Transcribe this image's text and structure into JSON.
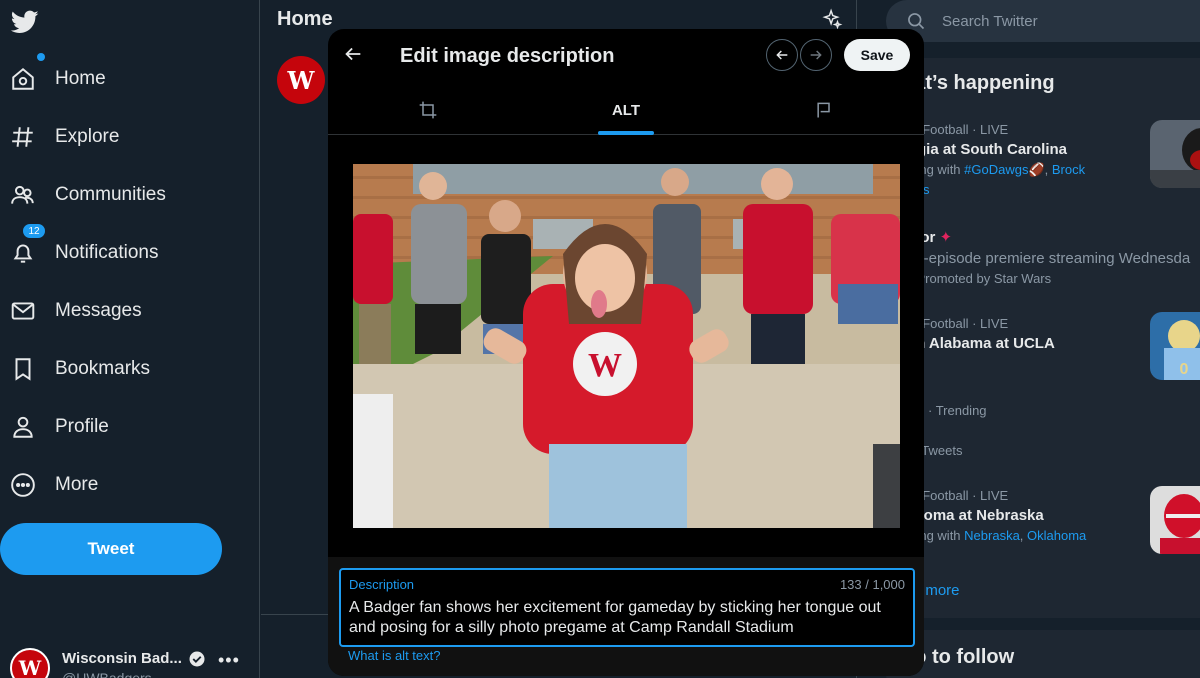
{
  "colors": {
    "background": "#15202b",
    "accent": "#1d9bf0",
    "modal": "#000000",
    "brand_red": "#c5050c"
  },
  "sidebar": {
    "logo_icon": "twitter-bird-icon",
    "items": [
      {
        "label": "Home",
        "icon": "home-icon"
      },
      {
        "label": "Explore",
        "icon": "hashtag-icon"
      },
      {
        "label": "Communities",
        "icon": "communities-icon"
      },
      {
        "label": "Notifications",
        "icon": "bell-icon",
        "badge": "12"
      },
      {
        "label": "Messages",
        "icon": "envelope-icon"
      },
      {
        "label": "Bookmarks",
        "icon": "bookmark-icon"
      },
      {
        "label": "Profile",
        "icon": "person-icon"
      },
      {
        "label": "More",
        "icon": "more-circle-icon"
      }
    ],
    "tweet_label": "Tweet",
    "account": {
      "name": "Wisconsin Bad...",
      "handle": "@UWBadgers",
      "avatar_text": "W"
    }
  },
  "center": {
    "title": "Home",
    "avatar_text": "W"
  },
  "right": {
    "search_placeholder": "Search Twitter",
    "trends_title": "hat’s happening",
    "trends": [
      {
        "meta": "AA Football · LIVE",
        "title": "orgia at South Carolina",
        "sub_prefix": "nding with ",
        "link1": "#GoDawgs",
        "link2": "Brock",
        "extra": "wers"
      },
      {
        "title": "ndor",
        "desc": "ree-episode premiere streaming Wednesda",
        "meta2": "Promoted by Star Wars"
      },
      {
        "meta": "AA Football · LIVE",
        "title": "uth Alabama at UCLA"
      },
      {
        "meta": "itics · Trending",
        "title": "etz",
        "sub": "3K Tweets"
      },
      {
        "meta": "AA Football · LIVE",
        "title": "lahoma at Nebraska",
        "sub_prefix": "nding with ",
        "link1": "Nebraska",
        "link2": "Oklahoma"
      }
    ],
    "show_more": "ow more",
    "follow_title": "ho to follow"
  },
  "modal": {
    "title": "Edit image description",
    "save_label": "Save",
    "tab_alt_label": "ALT",
    "description_label": "Description",
    "char_count": "133 / 1,000",
    "description_value": "A Badger fan shows her excitement for gameday by sticking her tongue out and posing for a silly photo pregame at Camp Randall Stadium",
    "alt_link": "What is alt text?"
  }
}
